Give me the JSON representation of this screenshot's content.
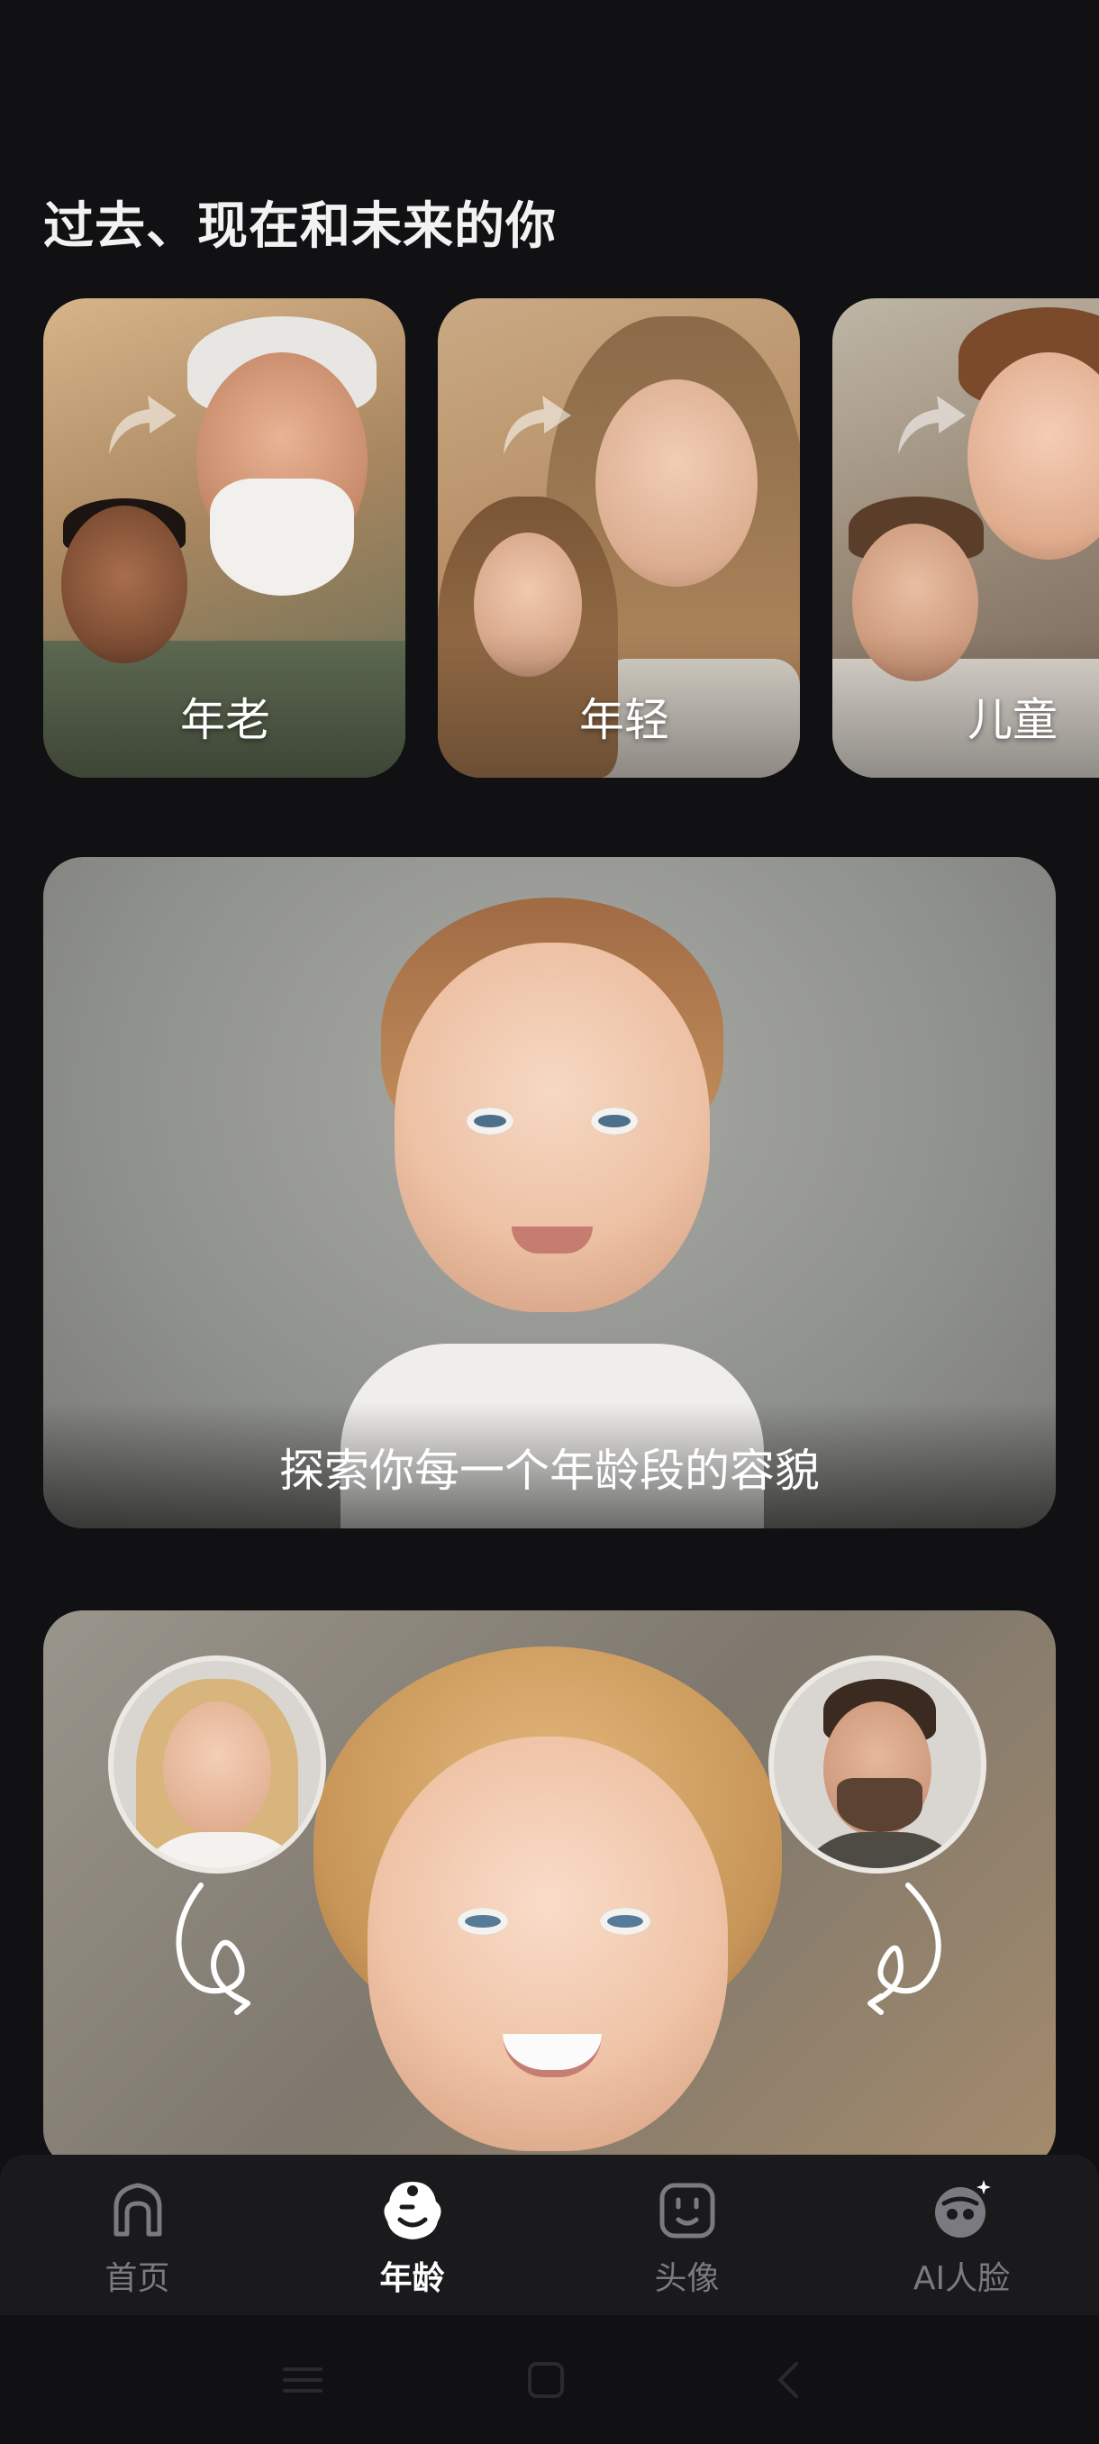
{
  "header": {
    "title": "过去、现在和未来的你"
  },
  "age_cards": [
    {
      "label": "年老",
      "arrow_icon": "curved-arrow-icon"
    },
    {
      "label": "年轻",
      "arrow_icon": "curved-arrow-icon"
    },
    {
      "label": "儿童",
      "arrow_icon": "curved-arrow-icon"
    }
  ],
  "feature_banner": {
    "caption": "探索你每一个年龄段的容貌"
  },
  "baby_banner": {
    "left_avatar_icon": "mother-avatar",
    "right_avatar_icon": "father-avatar"
  },
  "bottom_nav": {
    "items": [
      {
        "label": "首页",
        "icon": "home-icon",
        "active": false
      },
      {
        "label": "年龄",
        "icon": "age-face-icon",
        "active": true
      },
      {
        "label": "头像",
        "icon": "avatar-face-icon",
        "active": false
      },
      {
        "label": "AI人脸",
        "icon": "ai-face-icon",
        "active": false
      }
    ]
  },
  "system_nav": {
    "buttons": [
      "menu-icon",
      "home-square-icon",
      "back-chevron-icon"
    ]
  },
  "colors": {
    "background": "#111113",
    "nav_background": "#1a1a1d",
    "active_label": "#ffffff",
    "inactive_label": "#7a7a80"
  }
}
